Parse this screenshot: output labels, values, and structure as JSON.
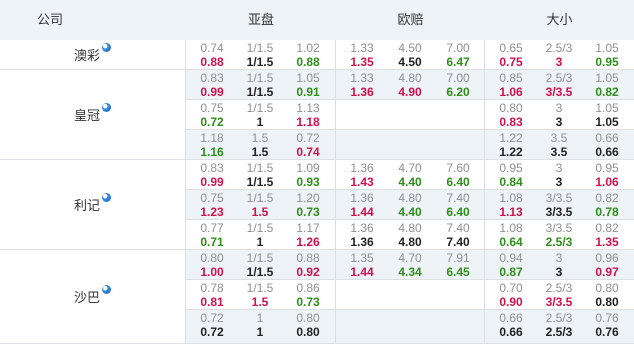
{
  "headers": {
    "company": "公司",
    "asian": "亚盘",
    "euro": "欧赔",
    "ou": "大小"
  },
  "colors": {
    "up": "#d0114b",
    "down": "#2e8f1a",
    "initial": "#8f8f8f",
    "header_bg": "#eef3f8",
    "alt_row_bg": "#eef3f7"
  },
  "companies": [
    {
      "name": "澳彩",
      "icon": "football-icon"
    },
    {
      "name": "皇冠",
      "icon": "football-icon"
    },
    {
      "name": "利记",
      "icon": "football-icon"
    },
    {
      "name": "沙巴",
      "icon": "football-icon"
    }
  ],
  "rows": [
    {
      "asian": {
        "init": [
          "0.74",
          "1/1.5",
          "1.02"
        ],
        "live": [
          "0.88",
          "1/1.5",
          "0.88"
        ],
        "dirs": [
          "up",
          "",
          "down"
        ]
      },
      "euro": {
        "init": [
          "1.33",
          "4.50",
          "7.00"
        ],
        "live": [
          "1.35",
          "4.50",
          "6.47"
        ],
        "dirs": [
          "up",
          "",
          "down"
        ]
      },
      "ou": {
        "init": [
          "0.65",
          "2.5/3",
          "1.05"
        ],
        "live": [
          "0.75",
          "3",
          "0.95"
        ],
        "dirs": [
          "up",
          "up",
          "down"
        ]
      }
    },
    {
      "asian": {
        "init": [
          "0.83",
          "1/1.5",
          "1.05"
        ],
        "live": [
          "0.99",
          "1/1.5",
          "0.91"
        ],
        "dirs": [
          "up",
          "",
          "down"
        ]
      },
      "euro": {
        "init": [
          "1.33",
          "4.80",
          "7.00"
        ],
        "live": [
          "1.36",
          "4.90",
          "6.20"
        ],
        "dirs": [
          "up",
          "up",
          "down"
        ]
      },
      "ou": {
        "init": [
          "0.85",
          "2.5/3",
          "1.05"
        ],
        "live": [
          "1.06",
          "3/3.5",
          "0.82"
        ],
        "dirs": [
          "up",
          "up",
          "down"
        ]
      }
    },
    {
      "asian": {
        "init": [
          "0.75",
          "1/1.5",
          "1.13"
        ],
        "live": [
          "0.72",
          "1",
          "1.18"
        ],
        "dirs": [
          "down",
          "",
          "up"
        ]
      },
      "euro": null,
      "ou": {
        "init": [
          "0.80",
          "3",
          "1.05"
        ],
        "live": [
          "0.83",
          "3",
          "1.05"
        ],
        "dirs": [
          "up",
          "",
          ""
        ]
      }
    },
    {
      "asian": {
        "init": [
          "1.18",
          "1.5",
          "0.72"
        ],
        "live": [
          "1.16",
          "1.5",
          "0.74"
        ],
        "dirs": [
          "down",
          "",
          "up"
        ]
      },
      "euro": null,
      "ou": {
        "init": [
          "1.22",
          "3.5",
          "0.66"
        ],
        "live": [
          "1.22",
          "3.5",
          "0.66"
        ],
        "dirs": [
          "",
          "",
          ""
        ]
      }
    },
    {
      "asian": {
        "init": [
          "0.83",
          "1/1.5",
          "1.09"
        ],
        "live": [
          "0.99",
          "1/1.5",
          "0.93"
        ],
        "dirs": [
          "up",
          "",
          "down"
        ]
      },
      "euro": {
        "init": [
          "1.36",
          "4.70",
          "7.60"
        ],
        "live": [
          "1.43",
          "4.40",
          "6.40"
        ],
        "dirs": [
          "up",
          "down",
          "down"
        ]
      },
      "ou": {
        "init": [
          "0.95",
          "3",
          "0.95"
        ],
        "live": [
          "0.84",
          "3",
          "1.06"
        ],
        "dirs": [
          "down",
          "",
          "up"
        ]
      }
    },
    {
      "asian": {
        "init": [
          "0.75",
          "1/1.5",
          "1.20"
        ],
        "live": [
          "1.23",
          "1.5",
          "0.73"
        ],
        "dirs": [
          "up",
          "up",
          "down"
        ]
      },
      "euro": {
        "init": [
          "1.36",
          "4.80",
          "7.40"
        ],
        "live": [
          "1.44",
          "4.40",
          "6.40"
        ],
        "dirs": [
          "up",
          "down",
          "down"
        ]
      },
      "ou": {
        "init": [
          "1.08",
          "3/3.5",
          "0.82"
        ],
        "live": [
          "1.13",
          "3/3.5",
          "0.78"
        ],
        "dirs": [
          "up",
          "",
          "down"
        ]
      }
    },
    {
      "asian": {
        "init": [
          "0.77",
          "1/1.5",
          "1.17"
        ],
        "live": [
          "0.71",
          "1",
          "1.26"
        ],
        "dirs": [
          "down",
          "",
          "up"
        ]
      },
      "euro": {
        "init": [
          "1.36",
          "4.80",
          "7.40"
        ],
        "live": [
          "1.36",
          "4.80",
          "7.40"
        ],
        "dirs": [
          "",
          "",
          ""
        ]
      },
      "ou": {
        "init": [
          "1.08",
          "3/3.5",
          "0.82"
        ],
        "live": [
          "0.64",
          "2.5/3",
          "1.35"
        ],
        "dirs": [
          "down",
          "down",
          "up"
        ]
      }
    },
    {
      "asian": {
        "init": [
          "0.80",
          "1/1.5",
          "0.88"
        ],
        "live": [
          "1.00",
          "1/1.5",
          "0.92"
        ],
        "dirs": [
          "up",
          "",
          "up"
        ]
      },
      "euro": {
        "init": [
          "1.35",
          "4.70",
          "7.91"
        ],
        "live": [
          "1.44",
          "4.34",
          "6.45"
        ],
        "dirs": [
          "up",
          "down",
          "down"
        ]
      },
      "ou": {
        "init": [
          "0.94",
          "3",
          "0.96"
        ],
        "live": [
          "0.87",
          "3",
          "0.97"
        ],
        "dirs": [
          "down",
          "",
          "up"
        ]
      }
    },
    {
      "asian": {
        "init": [
          "0.78",
          "1/1.5",
          "0.86"
        ],
        "live": [
          "0.81",
          "1.5",
          "0.73"
        ],
        "dirs": [
          "up",
          "up",
          "down"
        ]
      },
      "euro": null,
      "ou": {
        "init": [
          "0.70",
          "2.5/3",
          "0.80"
        ],
        "live": [
          "0.90",
          "3/3.5",
          "0.80"
        ],
        "dirs": [
          "up",
          "up",
          ""
        ]
      }
    },
    {
      "asian": {
        "init": [
          "0.72",
          "1",
          "0.80"
        ],
        "live": [
          "0.72",
          "1",
          "0.80"
        ],
        "dirs": [
          "",
          "",
          ""
        ]
      },
      "euro": null,
      "ou": {
        "init": [
          "0.66",
          "2.5/3",
          "0.76"
        ],
        "live": [
          "0.66",
          "2.5/3",
          "0.76"
        ],
        "dirs": [
          "",
          "",
          ""
        ]
      }
    }
  ]
}
